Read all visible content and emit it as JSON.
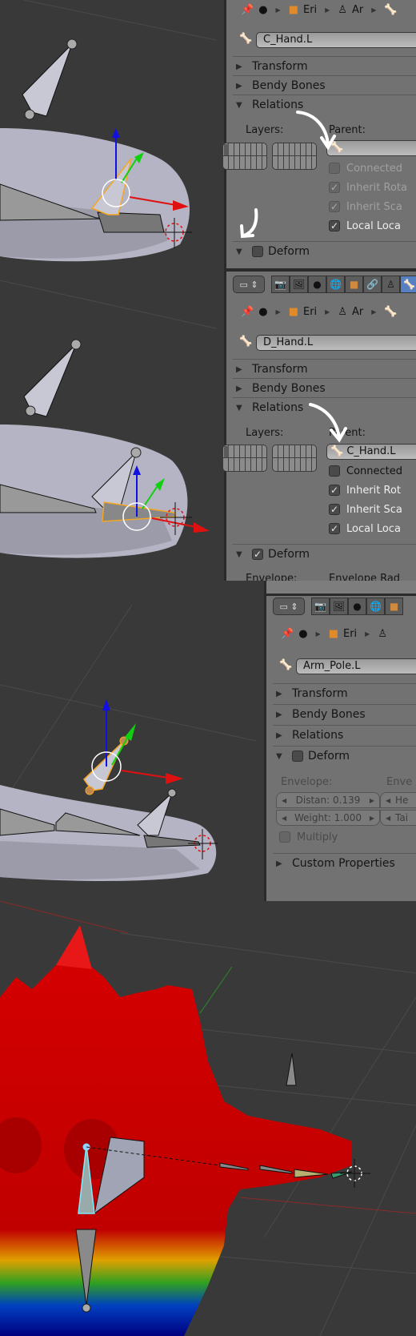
{
  "breadcrumb": {
    "items": [
      {
        "icon": "pin-icon",
        "label": ""
      },
      {
        "icon": "scene-objects-icon",
        "label": ""
      },
      {
        "icon": "object-cube-icon",
        "label": "Eri"
      },
      {
        "icon": "armature-icon",
        "label": "Ar"
      },
      {
        "icon": "bone-icon",
        "label": ""
      }
    ]
  },
  "panel1": {
    "bone_name": "C_Hand.L",
    "sections": {
      "transform": "Transform",
      "bendy": "Bendy Bones",
      "relations": "Relations",
      "deform": "Deform"
    },
    "layers_label": "Layers:",
    "parent_label": "Parent:",
    "parent_value": "",
    "checkboxes": [
      {
        "label": "Connected",
        "checked": false,
        "enabled": false
      },
      {
        "label": "Inherit Rota",
        "checked": true,
        "enabled": false
      },
      {
        "label": "Inherit Sca",
        "checked": true,
        "enabled": false
      },
      {
        "label": "Local Loca",
        "checked": true,
        "enabled": true
      }
    ],
    "deform_checked": false
  },
  "panel2": {
    "bone_name": "D_Hand.L",
    "sections": {
      "transform": "Transform",
      "bendy": "Bendy Bones",
      "relations": "Relations",
      "deform": "Deform"
    },
    "layers_label": "Layers:",
    "parent_label": "Parent:",
    "parent_value": "C_Hand.L",
    "checkboxes": [
      {
        "label": "Connected",
        "checked": false,
        "enabled": true
      },
      {
        "label": "Inherit Rot",
        "checked": true,
        "enabled": true
      },
      {
        "label": "Inherit Sca",
        "checked": true,
        "enabled": true
      },
      {
        "label": "Local Loca",
        "checked": true,
        "enabled": true
      }
    ],
    "deform_checked": true,
    "envelope_label": "Envelope:",
    "envelope_radius_label": "Envelope Rad"
  },
  "panel3": {
    "bone_name": "Arm_Pole.L",
    "sections": {
      "transform": "Transform",
      "bendy": "Bendy Bones",
      "relations": "Relations",
      "deform": "Deform",
      "custom": "Custom Properties"
    },
    "deform_checked": false,
    "envelope_label": "Envelope:",
    "envelope_radius_label": "Enve",
    "distance": "Distan:  0.139",
    "weight": "Weight: 1.000",
    "head": "He",
    "tail": "Tai",
    "multiply_label": "Multiply"
  },
  "property_tabs": [
    "render",
    "render-layers",
    "scene",
    "world",
    "object",
    "constraints",
    "armature",
    "bone"
  ],
  "colors": {
    "panel_bg": "#727272",
    "viewport_bg": "#393939",
    "active_tab": "#5680c2",
    "selected_bone": "#f5a623",
    "axis_x": "#e01010",
    "axis_y": "#10d010",
    "axis_z": "#1010e0",
    "mesh_red": "#d40000"
  }
}
